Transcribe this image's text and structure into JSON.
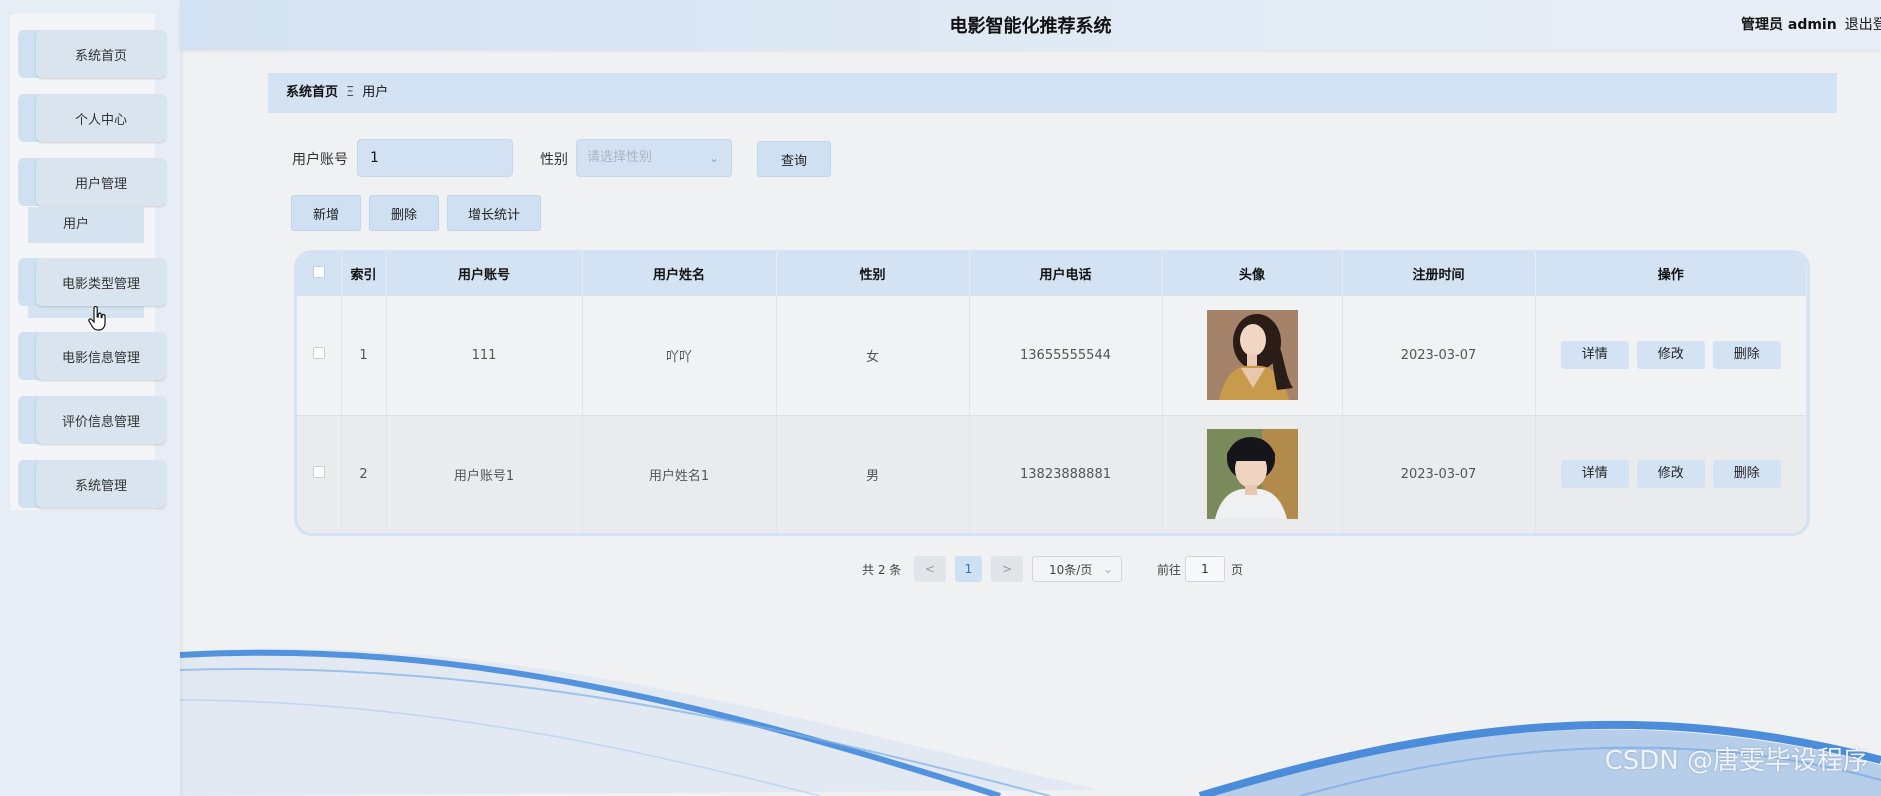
{
  "header": {
    "app_title": "电影智能化推荐系统",
    "user_label": "管理员 admin",
    "logout_label": "退出登"
  },
  "sidebar": {
    "items": [
      {
        "label": "系统首页"
      },
      {
        "label": "个人中心"
      },
      {
        "label": "用户管理"
      },
      {
        "label": "电影类型管理"
      },
      {
        "label": "电影信息管理"
      },
      {
        "label": "评价信息管理"
      },
      {
        "label": "系统管理"
      }
    ],
    "submenu_label": "用户"
  },
  "breadcrumb": {
    "home": "系统首页",
    "separator": "Ξ",
    "current": "用户"
  },
  "search": {
    "account_label": "用户账号",
    "account_value": "1",
    "gender_label": "性别",
    "gender_placeholder": "请选择性别",
    "query_label": "查询"
  },
  "actions": {
    "add_label": "新增",
    "delete_label": "删除",
    "stats_label": "增长统计"
  },
  "table": {
    "columns": [
      "索引",
      "用户账号",
      "用户姓名",
      "性别",
      "用户电话",
      "头像",
      "注册时间",
      "操作"
    ],
    "rows": [
      {
        "index": "1",
        "account": "111",
        "name": "吖吖",
        "gender": "女",
        "phone": "13655555544",
        "avatar": "female-portrait-photo",
        "date": "2023-03-07"
      },
      {
        "index": "2",
        "account": "用户账号1",
        "name": "用户姓名1",
        "gender": "男",
        "phone": "13823888881",
        "avatar": "male-portrait-photo",
        "date": "2023-03-07"
      }
    ],
    "op_labels": {
      "detail": "详情",
      "edit": "修改",
      "delete": "删除"
    }
  },
  "pagination": {
    "total": "共 2 条",
    "prev": "<",
    "page": "1",
    "next": ">",
    "page_size": "10条/页",
    "goto_label": "前往",
    "goto_value": "1",
    "page_suffix": "页"
  },
  "watermark": "CSDN @唐雯毕设程序",
  "colors": {
    "accent": "#d3e3f4",
    "active_page": "#cfe0f2",
    "wave": "#3b7fd4"
  }
}
